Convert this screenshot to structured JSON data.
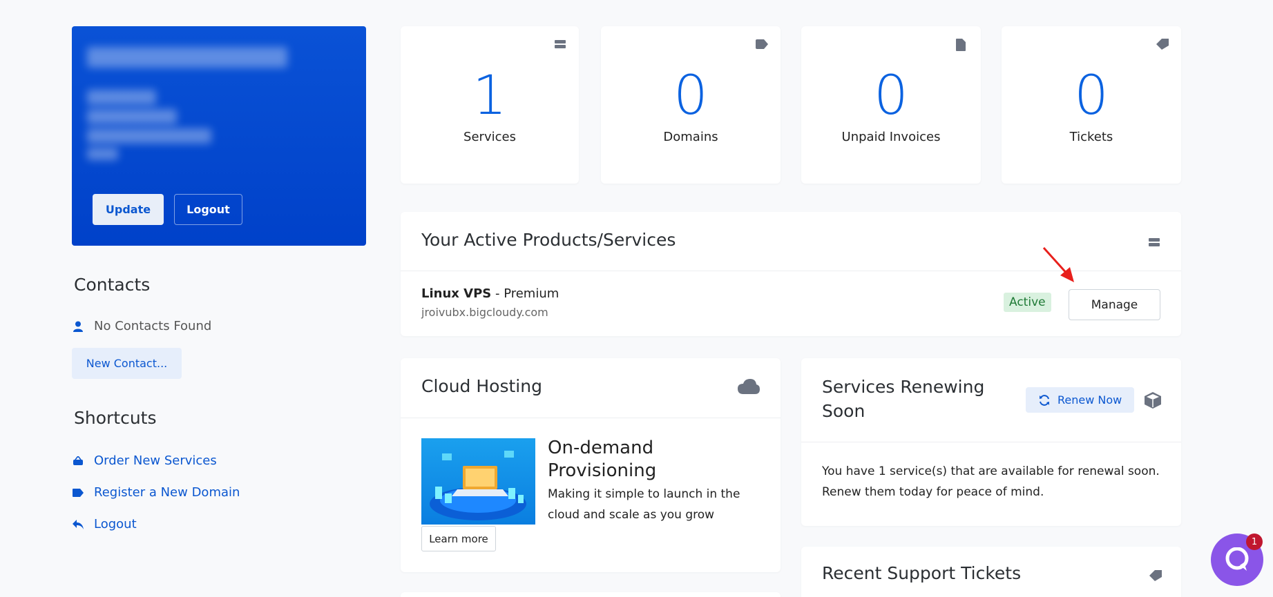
{
  "profile": {
    "update_label": "Update",
    "logout_label": "Logout"
  },
  "contacts": {
    "title": "Contacts",
    "empty_text": "No Contacts Found",
    "new_contact_label": "New Contact..."
  },
  "shortcuts": {
    "title": "Shortcuts",
    "items": [
      {
        "label": "Order New Services",
        "icon": "basket-icon"
      },
      {
        "label": "Register a New Domain",
        "icon": "tag-icon"
      },
      {
        "label": "Logout",
        "icon": "reply-arrow-icon"
      }
    ]
  },
  "stats": [
    {
      "value": "1",
      "label": "Services",
      "icon": "server-icon"
    },
    {
      "value": "0",
      "label": "Domains",
      "icon": "tag-icon"
    },
    {
      "value": "0",
      "label": "Unpaid Invoices",
      "icon": "document-icon"
    },
    {
      "value": "0",
      "label": "Tickets",
      "icon": "ticket-icon"
    }
  ],
  "active_products": {
    "title": "Your Active Products/Services",
    "product_name": "Linux VPS",
    "separator": " - ",
    "plan": "Premium",
    "domain": "jroivubx.bigcloudy.com",
    "status": "Active",
    "manage_label": "Manage"
  },
  "cloud_hosting": {
    "title": "Cloud Hosting",
    "promo_heading": "On-demand Provisioning",
    "promo_text": "Making it simple to launch in the cloud and scale as you grow",
    "learn_more_label": "Learn more"
  },
  "renewing": {
    "title": "Services Renewing Soon",
    "renew_label": "Renew Now",
    "body": "You have 1 service(s) that are available for renewal soon. Renew them today for peace of mind."
  },
  "support": {
    "title": "Recent Support Tickets"
  },
  "chat": {
    "badge_count": "1"
  },
  "colors": {
    "accent": "#0b57d0",
    "hero": "#0048d0",
    "active_badge_bg": "#d9f1df",
    "chat": "#8a55e8"
  }
}
